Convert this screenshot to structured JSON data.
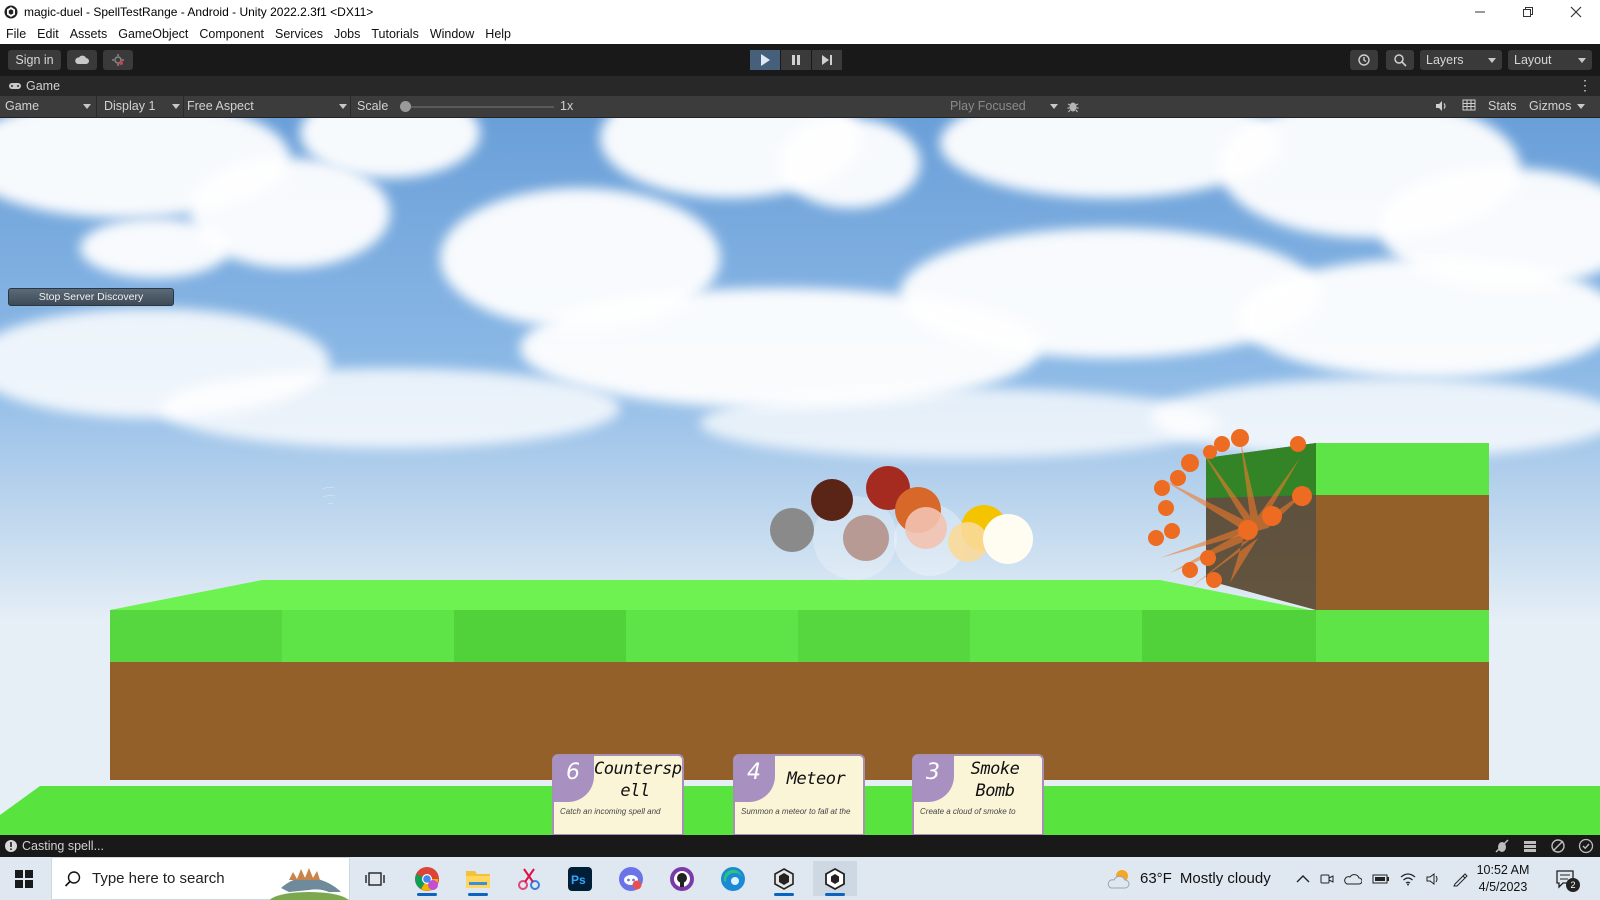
{
  "window": {
    "title": "magic-duel - SpellTestRange - Android - Unity 2022.2.3f1 <DX11>",
    "controls": [
      "minimize",
      "restore",
      "close"
    ]
  },
  "menu": [
    "File",
    "Edit",
    "Assets",
    "GameObject",
    "Component",
    "Services",
    "Jobs",
    "Tutorials",
    "Window",
    "Help"
  ],
  "toolbar": {
    "sign_in": "Sign in",
    "layers": "Layers",
    "layout": "Layout"
  },
  "game_tab": {
    "tab_label": "Game",
    "mode": "Game",
    "display": "Display 1",
    "aspect": "Free Aspect",
    "scale_label": "Scale",
    "scale_value": "1x",
    "scale_level": 0,
    "play_focused": "Play Focused",
    "stats": "Stats",
    "gizmos": "Gizmos"
  },
  "game": {
    "stop_button": "Stop Server Discovery",
    "cards": [
      {
        "cost": "6",
        "name": "Countersp ell",
        "desc": "Catch an incoming spell and redirect it at your will"
      },
      {
        "cost": "4",
        "name": "Meteor",
        "desc": "Summon a meteor to fall at the indicated point"
      },
      {
        "cost": "3",
        "name": "Smoke Bomb",
        "desc": "Create a cloud of smoke to obscure the field"
      }
    ],
    "colors": {
      "grass": "#5fe04a",
      "dirt": "#94602a",
      "card_purple": "#a890c0"
    }
  },
  "status": {
    "message": "Casting spell..."
  },
  "taskbar": {
    "search_placeholder": "Type here to search",
    "weather": {
      "temp": "63°F",
      "desc": "Mostly cloudy"
    },
    "time": "10:52 AM",
    "date": "4/5/2023",
    "notifications": "2",
    "apps": [
      "task-view",
      "chrome",
      "file-explorer",
      "snipping-tool",
      "photoshop",
      "discord",
      "github-desktop",
      "edge",
      "unity-hub",
      "unity-editor"
    ]
  }
}
